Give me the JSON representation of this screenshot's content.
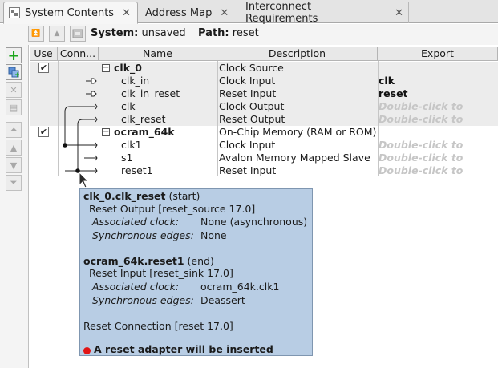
{
  "tabs": [
    {
      "label": "System Contents",
      "active": true
    },
    {
      "label": "Address Map",
      "active": false
    },
    {
      "label": "Interconnect Requirements",
      "active": false
    }
  ],
  "infobar": {
    "system_label": "System:",
    "system_value": "unsaved",
    "path_label": "Path:",
    "path_value": "reset"
  },
  "columns": [
    "Use",
    "Conn...",
    "Name",
    "Description",
    "Export"
  ],
  "rows": [
    {
      "use": true,
      "toggle": "−",
      "name": "clk_0",
      "description": "Clock Source",
      "export": "",
      "export_style": "none",
      "shade": true,
      "bold": true
    },
    {
      "use": null,
      "name": "clk_in",
      "description": "Clock Input",
      "export": "clk",
      "export_style": "bold",
      "shade": true,
      "bold": false
    },
    {
      "use": null,
      "name": "clk_in_reset",
      "description": "Reset Input",
      "export": "reset",
      "export_style": "bold",
      "shade": true,
      "bold": false
    },
    {
      "use": null,
      "name": "clk",
      "description": "Clock Output",
      "export": "Double-click to",
      "export_style": "hint",
      "shade": true,
      "bold": false
    },
    {
      "use": null,
      "name": "clk_reset",
      "description": "Reset Output",
      "export": "Double-click to",
      "export_style": "hint",
      "shade": true,
      "bold": false
    },
    {
      "use": true,
      "toggle": "−",
      "name": "ocram_64k",
      "description": "On-Chip Memory (RAM or ROM)",
      "export": "",
      "export_style": "none",
      "shade": false,
      "bold": true
    },
    {
      "use": null,
      "name": "clk1",
      "description": "Clock Input",
      "export": "Double-click to",
      "export_style": "hint",
      "shade": false,
      "bold": false
    },
    {
      "use": null,
      "name": "s1",
      "description": "Avalon Memory Mapped Slave",
      "export": "Double-click to",
      "export_style": "hint",
      "shade": false,
      "bold": false
    },
    {
      "use": null,
      "name": "reset1",
      "description": "Reset Input",
      "export": "Double-click to",
      "export_style": "hint",
      "shade": false,
      "bold": false
    }
  ],
  "tooltip": {
    "source_name": "clk_0.clk_reset",
    "source_role": "(start)",
    "source_type": "Reset Output [reset_source 17.0]",
    "source_assoc_key": "Associated clock:",
    "source_assoc_val": "None (asynchronous)",
    "source_sync_key": "Synchronous edges:",
    "source_sync_val": "None",
    "sink_name": "ocram_64k.reset1",
    "sink_role": "(end)",
    "sink_type": "Reset Input [reset_sink 17.0]",
    "sink_assoc_key": "Associated clock:",
    "sink_assoc_val": "ocram_64k.clk1",
    "sink_sync_key": "Synchronous edges:",
    "sink_sync_val": "Deassert",
    "connection": "Reset Connection [reset 17.0]",
    "warning": "A reset adapter will be inserted",
    "warning_color": "#e11515"
  },
  "colors": {
    "tooltip_bg": "#b8cde4",
    "add_green": "#1aa51a",
    "row_shade": "#ececec",
    "hint_text": "#c6c6c6"
  }
}
